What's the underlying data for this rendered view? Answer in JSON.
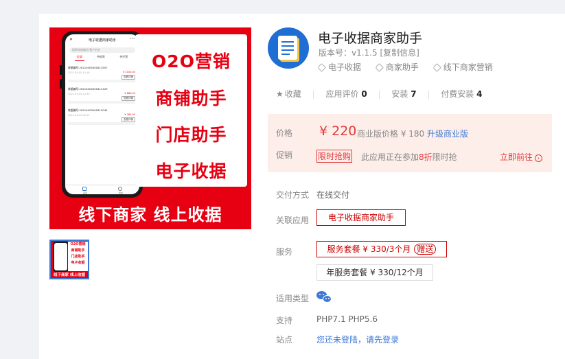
{
  "product_image": {
    "slogans": [
      "O2O营销",
      "商铺助手",
      "门店助手",
      "电子收据"
    ],
    "bottom_text": "线下商家 线上收据",
    "phone": {
      "title": "电子收据商家助手",
      "search": "搜索收据编号/客户姓名",
      "tabs": [
        "全部",
        "待收款",
        "待开票"
      ],
      "records": [
        {
          "no": "收据编号:20210405001813557",
          "date": "2021-04-05 10:18",
          "amount": "¥ 2100.00",
          "button": "查看详情"
        },
        {
          "no": "收据编号:20210404001813129",
          "date": "2021-04-04 14:30",
          "amount": "¥ 880.00",
          "button": "查看详情"
        },
        {
          "no": "收据编号:20210403001813045",
          "date": "2021-04-03 09:12",
          "amount": "¥ 365.00",
          "button": "查看详情"
        }
      ],
      "nav": [
        "首页",
        "我的"
      ]
    }
  },
  "thumbnail": {
    "slogans": [
      "O2O营销",
      "商铺助手",
      "门店助手",
      "电子收据"
    ],
    "bottom_text": "线下商家 线上收据"
  },
  "app": {
    "title": "电子收据商家助手",
    "version": "版本号：v1.1.5 [复制信息]",
    "tags": [
      "电子收据",
      "商家助手",
      "线下商家营销"
    ]
  },
  "stats": {
    "favorite": "收藏",
    "review_label": "应用评价",
    "review_count": "0",
    "install_label": "安装",
    "install_count": "7",
    "paid_label": "付费安装",
    "paid_count": "4"
  },
  "pricing": {
    "price_label": "价格",
    "price": "¥ 220",
    "business_text": "商业版价格 ¥ 180",
    "upgrade_link": "升级商业版",
    "promo_label": "促销",
    "promo_badge": "限时抢购",
    "promo_desc_pre": "此应用正在参加",
    "promo_discount": "8折",
    "promo_desc_post": "限时抢",
    "go_link": "立即前往"
  },
  "delivery": {
    "label": "交付方式",
    "value": "在线交付"
  },
  "related": {
    "label": "关联应用",
    "value": "电子收据商家助手"
  },
  "service": {
    "label": "服务",
    "options": [
      {
        "text": "服务套餐 ¥ 330/3个月",
        "gift": "赠送",
        "selected": true
      },
      {
        "text": "年服务套餐 ¥ 330/12个月",
        "selected": false
      }
    ]
  },
  "platform": {
    "label": "适用类型",
    "icon": "wechat-icon"
  },
  "support": {
    "label": "支持",
    "value": "PHP7.1 PHP5.6"
  },
  "site": {
    "label": "站点",
    "value": "您还未登陆，请先登录"
  },
  "colors": {
    "accent_red": "#e4393c",
    "link_blue": "#3d7ad6",
    "promo_bg": "#fdeee9"
  }
}
